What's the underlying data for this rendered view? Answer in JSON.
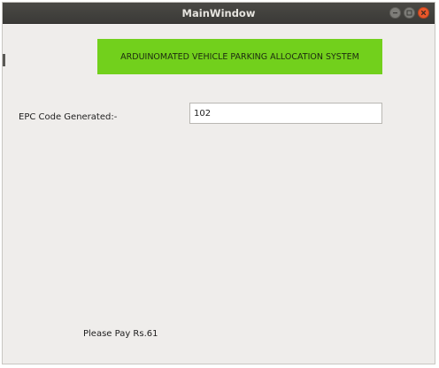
{
  "window": {
    "title": "MainWindow"
  },
  "titlebar_buttons": [
    {
      "name": "minimize",
      "icon": "minimize-icon"
    },
    {
      "name": "maximize",
      "icon": "maximize-icon"
    },
    {
      "name": "close",
      "icon": "close-icon"
    }
  ],
  "banner": {
    "text": "ARDUINOMATED VEHICLE PARKING ALLOCATION SYSTEM",
    "color": "#72d01c"
  },
  "epc": {
    "label": "EPC Code Generated:-",
    "value": "102"
  },
  "payment": {
    "text": "Please Pay Rs.61"
  },
  "colors": {
    "titlebar": "#3b3a37",
    "window_bg": "#efedeb",
    "close_button": "#e9572b"
  }
}
